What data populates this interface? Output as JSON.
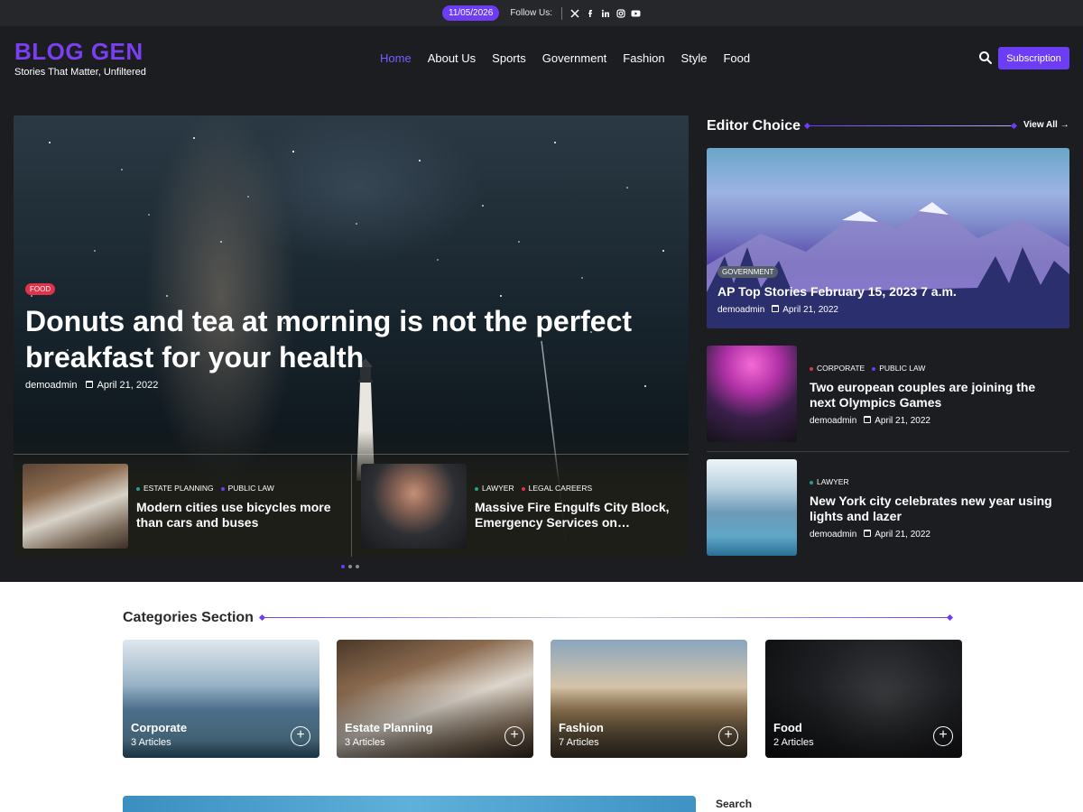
{
  "topbar": {
    "date": "11/05/2026",
    "follow_label": "Follow Us:",
    "social_icons": [
      "x-icon",
      "facebook-icon",
      "linkedin-icon",
      "instagram-icon",
      "youtube-icon"
    ]
  },
  "header": {
    "logo": "BLOG GEN",
    "tagline": "Stories That Matter, Unfiltered",
    "nav": [
      "Home",
      "About Us",
      "Sports",
      "Government",
      "Fashion",
      "Style",
      "Food"
    ],
    "active_nav": "Home",
    "subscription_label": "Subscription"
  },
  "hero": {
    "category": "FOOD",
    "title": "Donuts and tea at morning is not the perfect breakfast for your health",
    "author": "demoadmin",
    "date": "April 21, 2022"
  },
  "slider": {
    "items": [
      {
        "categories": [
          "ESTATE PLANNING",
          "PUBLIC LAW"
        ],
        "category_colors": [
          "#2a9d8f",
          "#6d3cf5"
        ],
        "title": "Modern cities use bicycles more than cars and buses"
      },
      {
        "categories": [
          "LAWYER",
          "LEGAL CAREERS"
        ],
        "category_colors": [
          "#2a9d8f",
          "#e0334a"
        ],
        "title": "Massive Fire Engulfs City Block, Emergency Services on…"
      }
    ]
  },
  "editor_choice": {
    "title": "Editor Choice",
    "view_all": "View All",
    "main": {
      "category": "GOVERNMENT",
      "title": "AP Top Stories February 15, 2023 7 a.m.",
      "author": "demoadmin",
      "date": "April 21, 2022"
    },
    "items": [
      {
        "categories": [
          "CORPORATE",
          "PUBLIC LAW"
        ],
        "category_colors": [
          "#e0334a",
          "#6d3cf5"
        ],
        "title": "Two european couples are joining the next Olympics Games",
        "author": "demoadmin",
        "date": "April 21, 2022"
      },
      {
        "categories": [
          "LAWYER"
        ],
        "category_colors": [
          "#2a9d8f"
        ],
        "title": "New York city celebrates new year using lights and lazer",
        "author": "demoadmin",
        "date": "April 21, 2022"
      }
    ]
  },
  "categories": {
    "title": "Categories Section",
    "items": [
      {
        "name": "Corporate",
        "count": "3 Articles"
      },
      {
        "name": "Estate Planning",
        "count": "3 Articles"
      },
      {
        "name": "Fashion",
        "count": "7 Articles"
      },
      {
        "name": "Food",
        "count": "2 Articles"
      }
    ]
  },
  "sidebar": {
    "search_label": "Search"
  },
  "colors": {
    "accent": "#6d3cf5",
    "dark_bg": "#1c1d21",
    "topbar_bg": "#26272b",
    "food_tag": "#e0334a"
  }
}
